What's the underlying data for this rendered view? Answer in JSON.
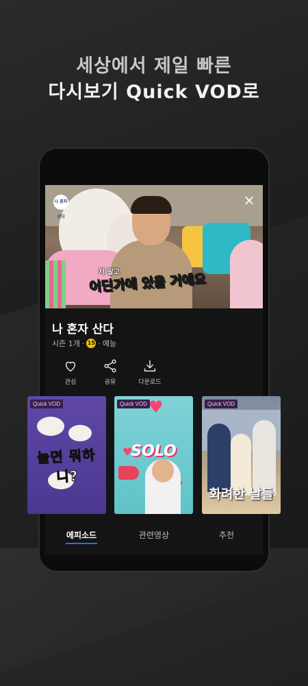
{
  "headline": {
    "line1": "세상에서 제일 빠른",
    "line2": "다시보기 Quick VOD로"
  },
  "player": {
    "channel_logo": "나 혼자 산다",
    "caption_small": "저 말고",
    "caption": "어딘가에 있을 거예요",
    "close_icon": "×"
  },
  "show": {
    "title": "나 혼자 산다",
    "season": "시즌 1개",
    "sep1": "·",
    "age": "15",
    "sep2": "·",
    "genre": "예능"
  },
  "actions": [
    {
      "label": "관심",
      "icon": "heart-outline-icon"
    },
    {
      "label": "공유",
      "icon": "share-icon"
    },
    {
      "label": "다운로드",
      "icon": "download-icon"
    }
  ],
  "cards": [
    {
      "badge": "Quick VOD",
      "title": "놀면 뭐하니?"
    },
    {
      "badge": "Quick VOD",
      "title": "SOLO"
    },
    {
      "badge": "Quick VOD",
      "title": "화려한 날들"
    }
  ],
  "tabs": [
    {
      "label": "에피소드",
      "active": true
    },
    {
      "label": "관련영상",
      "active": false
    },
    {
      "label": "추천",
      "active": false
    }
  ],
  "colors": {
    "accent": "#2b6cf5",
    "age_badge": "#f2c200",
    "background": "#1f1f1f"
  }
}
